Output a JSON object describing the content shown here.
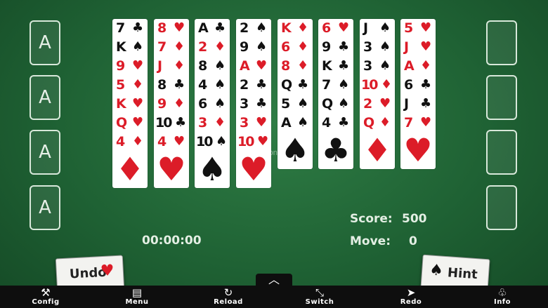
{
  "foundations": [
    "A",
    "A",
    "A",
    "A"
  ],
  "columns": [
    [
      [
        "7",
        "♣"
      ],
      [
        "K",
        "♠"
      ],
      [
        "9",
        "♥"
      ],
      [
        "5",
        "♦"
      ],
      [
        "K",
        "♥"
      ],
      [
        "Q",
        "♥"
      ],
      [
        "4",
        "♦"
      ]
    ],
    [
      [
        "8",
        "♥"
      ],
      [
        "7",
        "♦"
      ],
      [
        "J",
        "♦"
      ],
      [
        "8",
        "♣"
      ],
      [
        "9",
        "♦"
      ],
      [
        "10",
        "♣"
      ],
      [
        "4",
        "♥"
      ]
    ],
    [
      [
        "A",
        "♣"
      ],
      [
        "2",
        "♦"
      ],
      [
        "8",
        "♠"
      ],
      [
        "4",
        "♠"
      ],
      [
        "6",
        "♠"
      ],
      [
        "3",
        "♦"
      ],
      [
        "10",
        "♠"
      ]
    ],
    [
      [
        "2",
        "♠"
      ],
      [
        "9",
        "♠"
      ],
      [
        "A",
        "♥"
      ],
      [
        "2",
        "♣"
      ],
      [
        "3",
        "♣"
      ],
      [
        "3",
        "♥"
      ],
      [
        "10",
        "♥"
      ]
    ],
    [
      [
        "K",
        "♦"
      ],
      [
        "6",
        "♦"
      ],
      [
        "8",
        "♦"
      ],
      [
        "Q",
        "♣"
      ],
      [
        "5",
        "♠"
      ],
      [
        "A",
        "♠"
      ]
    ],
    [
      [
        "6",
        "♥"
      ],
      [
        "9",
        "♣"
      ],
      [
        "K",
        "♣"
      ],
      [
        "7",
        "♠"
      ],
      [
        "Q",
        "♠"
      ],
      [
        "4",
        "♣"
      ]
    ],
    [
      [
        "J",
        "♠"
      ],
      [
        "3",
        "♠"
      ],
      [
        "3",
        "♠"
      ],
      [
        "10",
        "♦"
      ],
      [
        "2",
        "♥"
      ],
      [
        "Q",
        "♦"
      ]
    ],
    [
      [
        "5",
        "♥"
      ],
      [
        "J",
        "♥"
      ],
      [
        "A",
        "♦"
      ],
      [
        "6",
        "♣"
      ],
      [
        "J",
        "♣"
      ],
      [
        "7",
        "♥"
      ]
    ]
  ],
  "hud": {
    "score_label": "Score:",
    "score_value": "500",
    "move_label": "Move:",
    "move_value": "0",
    "timer": "00:00:00"
  },
  "buttons": {
    "undo": "Undo",
    "undo_suit": "♥",
    "hint": "Hint",
    "hint_suit": "♠",
    "expand": "︿"
  },
  "watermark": "Updated on ...",
  "toolbar": [
    {
      "label": "Config",
      "icon": "⚒"
    },
    {
      "label": "Menu",
      "icon": "▤"
    },
    {
      "label": "Reload",
      "icon": "↻"
    },
    {
      "label": "Switch",
      "icon": "⤡"
    },
    {
      "label": "Redo",
      "icon": "➤"
    },
    {
      "label": "Info",
      "icon": "♧"
    }
  ],
  "colors": {
    "felt": "#1f6234",
    "red_suit": "#dc1c28",
    "black_suit": "#111111"
  }
}
